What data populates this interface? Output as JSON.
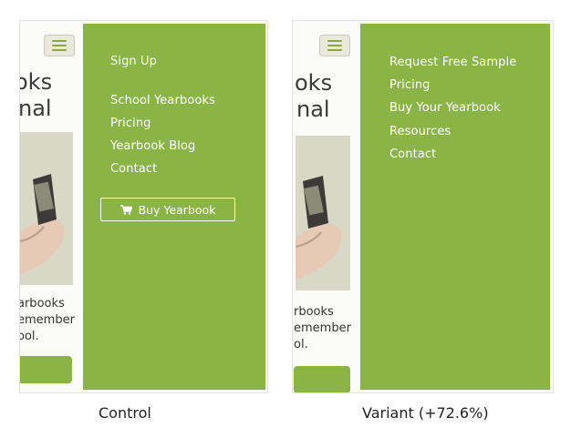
{
  "control": {
    "hero_line1": "oks",
    "hero_line2": "nal",
    "body_line1": "arbooks",
    "body_line2": "emember",
    "body_line3": "ool.",
    "menu": [
      "Sign Up",
      "School Yearbooks",
      "Pricing",
      "Yearbook Blog",
      "Contact"
    ],
    "buy_button_label": "Buy Yearbook",
    "caption": "Control"
  },
  "variant": {
    "hero_line1": "oks",
    "hero_line2": "nal",
    "body_line1": "rbooks",
    "body_line2": "emember",
    "body_line3": "ol.",
    "menu": [
      "Request Free Sample",
      "Pricing",
      "Buy Your Yearbook",
      "Resources",
      "Contact"
    ],
    "caption": "Variant (+72.6%)"
  },
  "colors": {
    "drawer_green": "#8ab446",
    "text_white": "#ffffff"
  },
  "icons": {
    "menu": "hamburger-icon",
    "cart": "cart-icon"
  }
}
